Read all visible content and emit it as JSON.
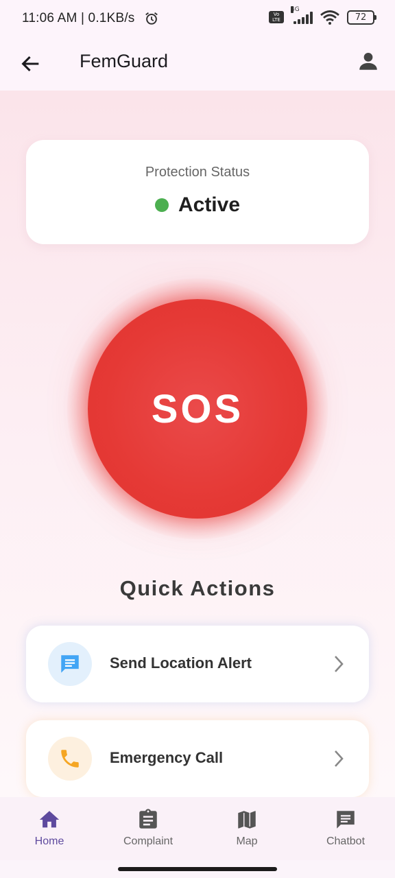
{
  "status_bar": {
    "time": "11:06 AM | 0.1KB/s",
    "network_label": "4G",
    "volte_label": "Vo LTE",
    "battery": "72"
  },
  "app_bar": {
    "title": "FemGuard"
  },
  "protection": {
    "label": "Protection Status",
    "value": "Active",
    "status_color": "#4caf50"
  },
  "sos": {
    "label": "SOS",
    "color": "#e53935"
  },
  "quick_actions": {
    "title": "Quick Actions",
    "items": [
      {
        "label": "Send Location Alert",
        "icon": "message-icon",
        "color": "#42a5f5"
      },
      {
        "label": "Emergency Call",
        "icon": "phone-icon",
        "color": "#f5a623"
      }
    ]
  },
  "bottom_nav": {
    "items": [
      {
        "label": "Home",
        "icon": "home-icon",
        "active": true
      },
      {
        "label": "Complaint",
        "icon": "clipboard-icon",
        "active": false
      },
      {
        "label": "Map",
        "icon": "map-icon",
        "active": false
      },
      {
        "label": "Chatbot",
        "icon": "chat-icon",
        "active": false
      }
    ],
    "active_color": "#5e4a9e"
  }
}
